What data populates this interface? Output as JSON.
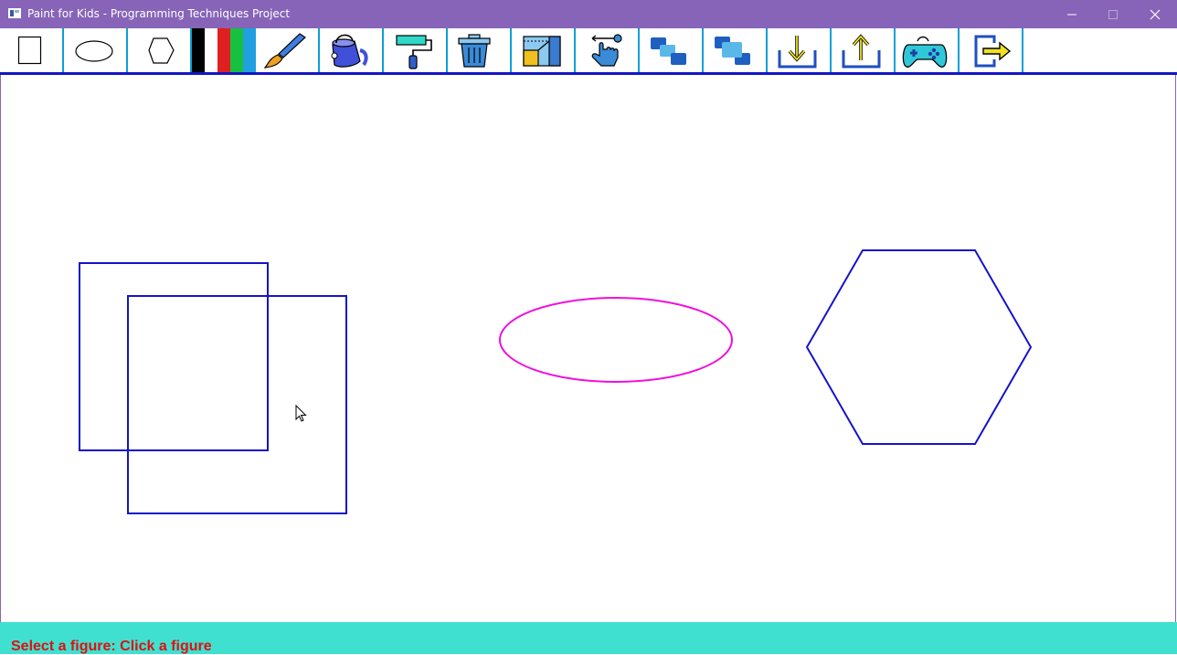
{
  "window": {
    "title": "Paint for Kids - Programming Techniques Project",
    "title_bar_color": "#8764b8"
  },
  "toolbar": {
    "items": [
      {
        "name": "draw-rectangle",
        "icon": "rectangle-icon"
      },
      {
        "name": "draw-ellipse",
        "icon": "ellipse-icon"
      },
      {
        "name": "draw-hexagon",
        "icon": "hexagon-icon"
      },
      {
        "name": "color-palette",
        "icon": "color-palette-icon",
        "colors": [
          "#000000",
          "#ffffff",
          "#e02020",
          "#18c040",
          "#20a0e0"
        ]
      },
      {
        "name": "change-draw-color",
        "icon": "brush-icon"
      },
      {
        "name": "change-fill-color",
        "icon": "paint-bucket-icon"
      },
      {
        "name": "change-background",
        "icon": "paint-roller-icon"
      },
      {
        "name": "delete-figure",
        "icon": "trash-icon"
      },
      {
        "name": "resize-figure",
        "icon": "resize-icon"
      },
      {
        "name": "move-figure",
        "icon": "drag-hand-icon"
      },
      {
        "name": "send-to-back",
        "icon": "send-back-icon"
      },
      {
        "name": "bring-to-front",
        "icon": "bring-front-icon"
      },
      {
        "name": "load-graph",
        "icon": "download-icon"
      },
      {
        "name": "save-graph",
        "icon": "upload-icon"
      },
      {
        "name": "play-mode",
        "icon": "gamepad-icon"
      },
      {
        "name": "exit",
        "icon": "exit-icon"
      }
    ],
    "separator_color": "#0aa0d8",
    "underline_color": "#1414c8"
  },
  "canvas": {
    "figures": [
      {
        "type": "rectangle",
        "draw_color": "#1414c8",
        "filled": false,
        "selected": false
      },
      {
        "type": "rectangle",
        "draw_color": "#1414c8",
        "filled": false,
        "selected": false
      },
      {
        "type": "ellipse",
        "draw_color": "#ee10e0",
        "filled": false,
        "selected": false
      },
      {
        "type": "hexagon",
        "draw_color": "#1414c8",
        "filled": false,
        "selected": false
      }
    ]
  },
  "status": {
    "message": "Select a figure: Click a figure",
    "text_color": "#e01010",
    "background": "#40e0d0"
  }
}
